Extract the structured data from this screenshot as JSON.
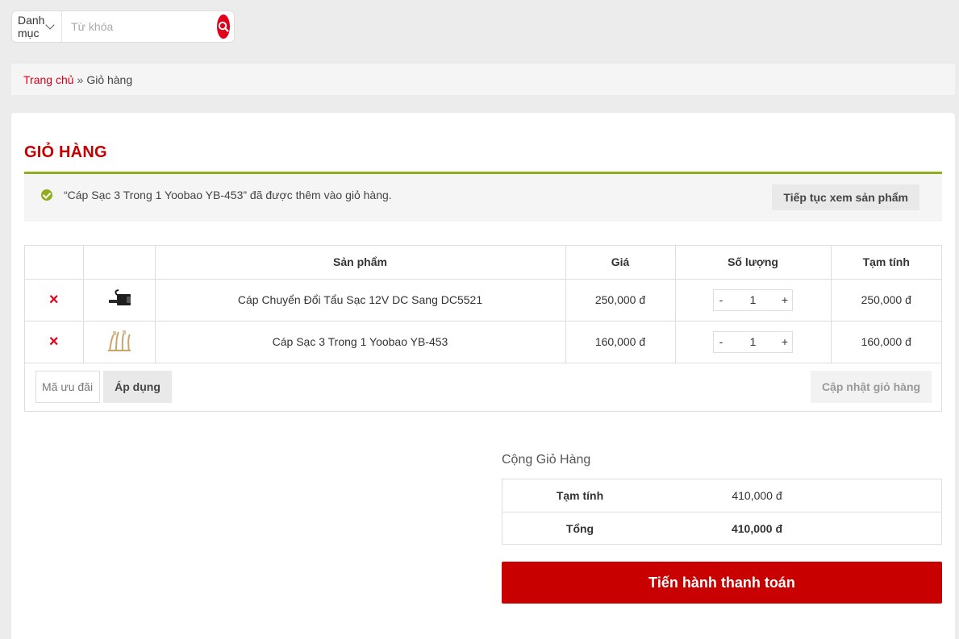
{
  "search": {
    "category_label": "Danh mục",
    "keyword_placeholder": "Từ khóa"
  },
  "breadcrumb": {
    "home": "Trang chủ",
    "separator": "»",
    "current": "Giỏ hàng"
  },
  "cart": {
    "title": "GIỎ HÀNG",
    "notice_message": "“Cáp Sạc 3 Trong 1 Yoobao YB-453” đã được thêm vào giỏ hàng.",
    "continue_button": "Tiếp tục xem sản phẩm",
    "columns": [
      "",
      "",
      "Sản phẩm",
      "Giá",
      "Số lượng",
      "Tạm tính"
    ],
    "items": [
      {
        "name": "Cáp Chuyển Đổi Tẩu Sạc 12V DC Sang DC5521",
        "price": "250,000 đ",
        "qty": "1",
        "subtotal": "250,000 đ",
        "thumb_icon": "dc-adapter-cable-thumbnail"
      },
      {
        "name": "Cáp Sạc 3 Trong 1 Yoobao YB-453",
        "price": "160,000 đ",
        "qty": "1",
        "subtotal": "160,000 đ",
        "thumb_icon": "gold-charging-cable-thumbnail"
      }
    ],
    "remove_symbol": "×",
    "qty_minus": "-",
    "qty_plus": "+",
    "coupon_placeholder": "Mã ưu đãi",
    "apply_button": "Áp dụng",
    "update_button": "Cập nhật giỏ hàng"
  },
  "totals": {
    "title": "Cộng Giỏ Hàng",
    "subtotal_label": "Tạm tính",
    "subtotal_value": "410,000 đ",
    "total_label": "Tổng",
    "total_value": "410,000 đ",
    "checkout_button": "Tiến hành thanh toán"
  },
  "colors": {
    "accent": "#c40000",
    "success": "#8fae1b",
    "search_button": "#e2001a"
  }
}
